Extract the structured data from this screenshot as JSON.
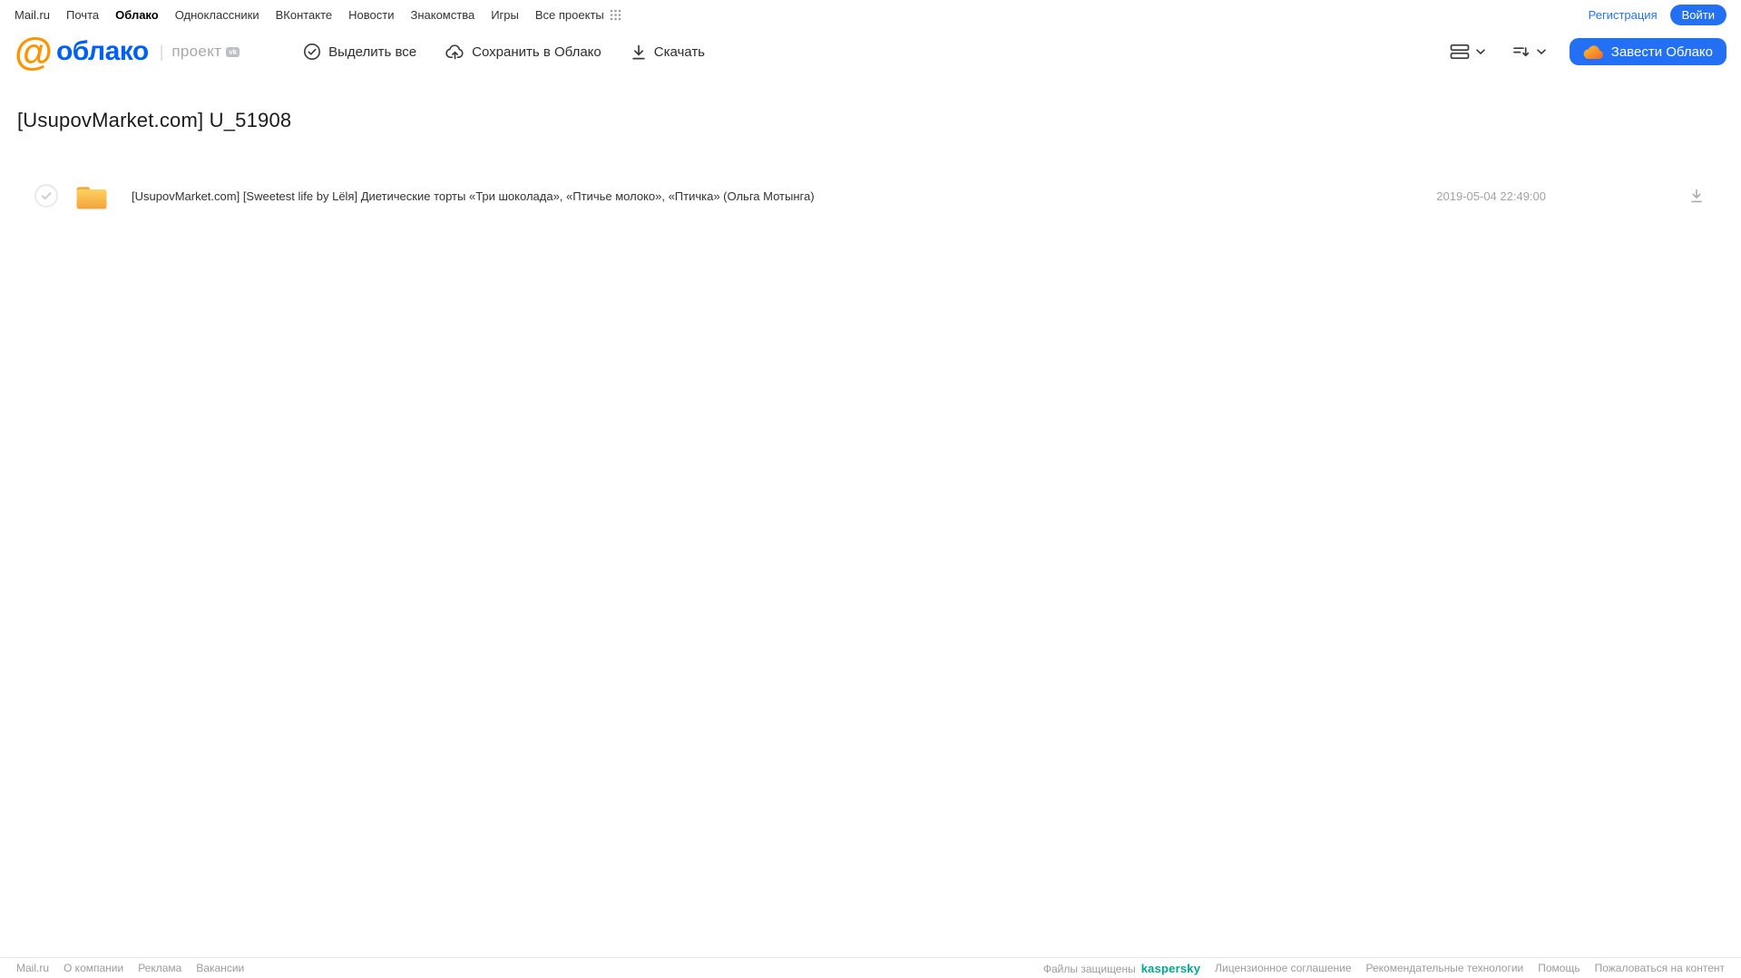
{
  "topnav": {
    "links": [
      "Mail.ru",
      "Почта",
      "Облако",
      "Одноклассники",
      "ВКонтакте",
      "Новости",
      "Знакомства",
      "Игры"
    ],
    "active_link": "Облако",
    "all_projects": "Все проекты",
    "registration": "Регистрация",
    "login": "Войти"
  },
  "header": {
    "logo_at": "@",
    "logo_text": "облако",
    "project_label": "проект",
    "vk_badge": "vk",
    "toolbar": {
      "select_all": "Выделить все",
      "save_to_cloud": "Сохранить в Облако",
      "download": "Скачать"
    },
    "get_cloud_button": "Завести Облако"
  },
  "main": {
    "title": "[UsupovMarket.com] U_51908",
    "files": [
      {
        "type": "folder",
        "name": "[UsupovMarket.com] [Sweetest life by Lëlя] Диетические торты «Три шоколада», «Птичье молоко», «Птичка» (Ольга Мотынга)",
        "date": "2019-05-04 22:49:00"
      }
    ]
  },
  "footer": {
    "left_links": [
      "Mail.ru",
      "О компании",
      "Реклама",
      "Вакансии"
    ],
    "protected_prefix": "Файлы защищены",
    "kaspersky": "kaspersky",
    "right_links": [
      "Лицензионное соглашение",
      "Рекомендательные технологии",
      "Помощь",
      "Пожаловаться на контент"
    ]
  },
  "colors": {
    "brand_blue": "#2470f5",
    "logo_blue": "#005ff9",
    "logo_orange": "#ff9400",
    "folder_top": "#ffd15f",
    "folder_bottom": "#f2a33c",
    "kaspersky_teal": "#00a88e",
    "muted_gray": "#a3a3a3"
  }
}
